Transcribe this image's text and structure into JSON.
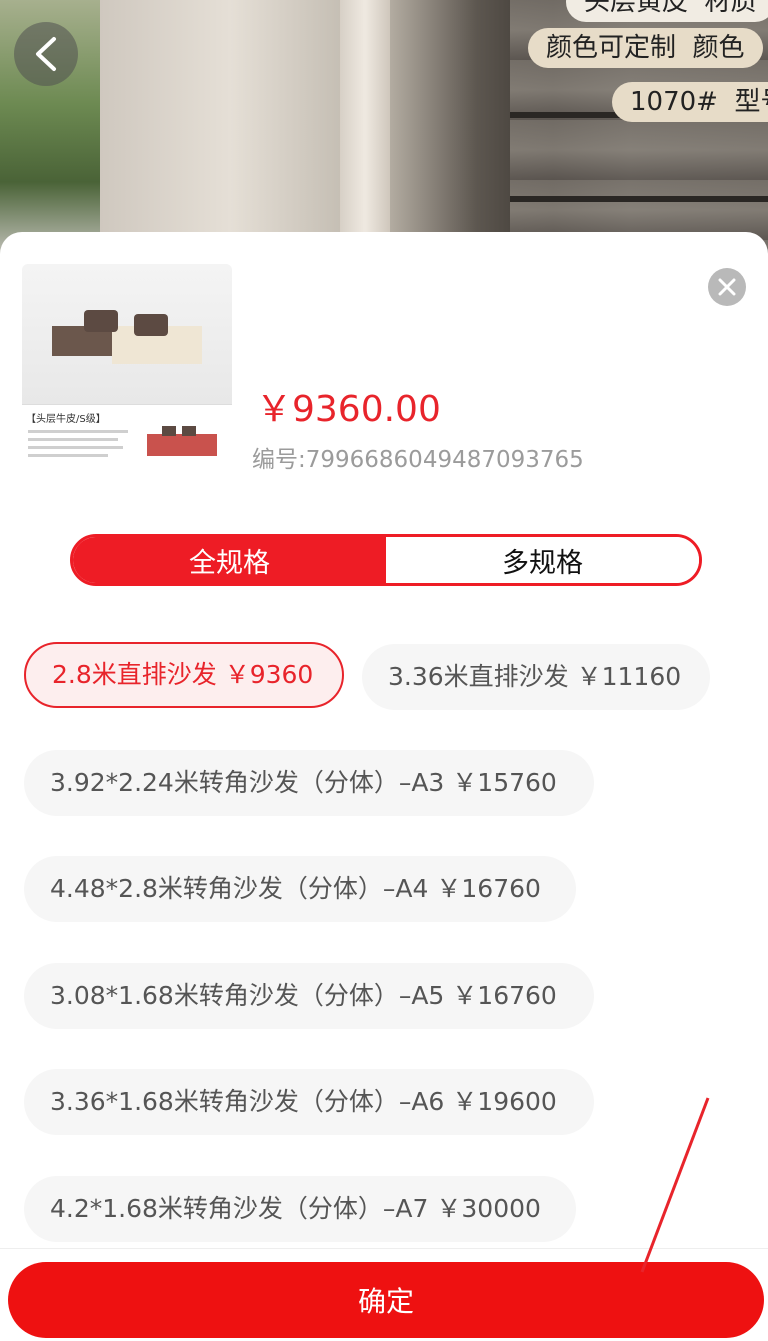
{
  "hero": {
    "tags": [
      {
        "text": "头层黄皮",
        "extra": "材质"
      },
      {
        "text": "颜色可定制",
        "extra": "颜色"
      },
      {
        "text": "1070#",
        "extra": "型号"
      }
    ]
  },
  "product": {
    "price": "￥9360.00",
    "code": "编号:7996686049487093765",
    "thumb_caption": "【头层牛皮/S级】"
  },
  "spec_tabs": [
    "全规格",
    "多规格"
  ],
  "options": [
    "2.8米直排沙发 ￥9360",
    "3.36米直排沙发 ￥11160",
    "3.92*2.24米转角沙发（分体）–A3 ￥15760",
    "4.48*2.8米转角沙发（分体）–A4 ￥16760",
    "3.08*1.68米转角沙发（分体）–A5 ￥16760",
    "3.36*1.68米转角沙发（分体）–A6 ￥19600",
    "4.2*1.68米转角沙发（分体）–A7 ￥30000"
  ],
  "confirm_label": "确定",
  "colors": {
    "accent": "#ee1c25",
    "price": "#e8242b"
  }
}
